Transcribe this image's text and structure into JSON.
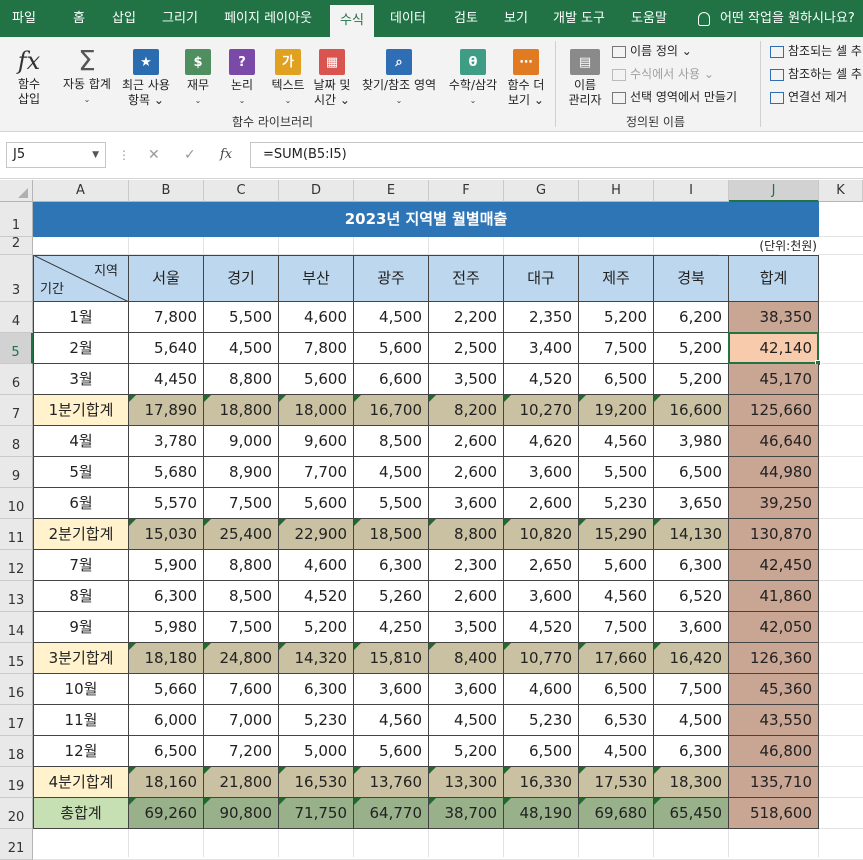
{
  "ribbon_tabs": [
    "파일",
    "홈",
    "삽입",
    "그리기",
    "페이지 레이아웃",
    "수식",
    "데이터",
    "검토",
    "보기",
    "개발 도구",
    "도움말"
  ],
  "active_tab": "수식",
  "tell_me": "어떤 작업을 원하시나요?",
  "ribbon": {
    "insert_function": [
      "함수",
      "삽입"
    ],
    "autosum": [
      "자동 합계",
      "⌄"
    ],
    "recent": [
      "최근 사용",
      "항목 ⌄"
    ],
    "finance": [
      "재무",
      "⌄"
    ],
    "logical": [
      "논리",
      "⌄"
    ],
    "text": [
      "텍스트",
      "⌄"
    ],
    "datetime": [
      "날짜 및",
      "시간 ⌄"
    ],
    "lookup": [
      "찾기/참조 영역",
      "⌄"
    ],
    "math": [
      "수학/삼각",
      "⌄"
    ],
    "more": [
      "함수 더",
      "보기 ⌄"
    ],
    "library_label": "함수 라이브러리",
    "name_manager": [
      "이름",
      "관리자"
    ],
    "define_name": "이름 정의 ⌄",
    "use_in_formula": "수식에서 사용 ⌄",
    "create_from_selection": "선택 영역에서 만들기",
    "defined_names_label": "정의된 이름",
    "trace_precedents": "참조되는 셀 추",
    "trace_dependents": "참조하는 셀 추",
    "remove_arrows": "연결선 제거"
  },
  "name_box": "J5",
  "formula": "=SUM(B5:I5)",
  "columns": [
    "A",
    "B",
    "C",
    "D",
    "E",
    "F",
    "G",
    "H",
    "I",
    "J",
    "K"
  ],
  "rows": [
    "1",
    "2",
    "3",
    "4",
    "5",
    "6",
    "7",
    "8",
    "9",
    "10",
    "11",
    "12",
    "13",
    "14",
    "15",
    "16",
    "17",
    "18",
    "19",
    "20",
    "21"
  ],
  "title": "2023년 지역별 월별매출",
  "unit": "(단위:천원)",
  "corner_top": "지역",
  "corner_bottom": "기간",
  "regions": [
    "서울",
    "경기",
    "부산",
    "광주",
    "전주",
    "대구",
    "제주",
    "경북"
  ],
  "total_header": "합계",
  "table": [
    {
      "label": "1월",
      "type": "month",
      "values": [
        "7,800",
        "5,500",
        "4,600",
        "4,500",
        "2,200",
        "2,350",
        "5,200",
        "6,200"
      ],
      "total": "38,350"
    },
    {
      "label": "2월",
      "type": "month",
      "values": [
        "5,640",
        "4,500",
        "7,800",
        "5,600",
        "2,500",
        "3,400",
        "7,500",
        "5,200"
      ],
      "total": "42,140"
    },
    {
      "label": "3월",
      "type": "month",
      "values": [
        "4,450",
        "8,800",
        "5,600",
        "6,600",
        "3,500",
        "4,520",
        "6,500",
        "5,200"
      ],
      "total": "45,170"
    },
    {
      "label": "1분기합계",
      "type": "quarter",
      "values": [
        "17,890",
        "18,800",
        "18,000",
        "16,700",
        "8,200",
        "10,270",
        "19,200",
        "16,600"
      ],
      "total": "125,660"
    },
    {
      "label": "4월",
      "type": "month",
      "values": [
        "3,780",
        "9,000",
        "9,600",
        "8,500",
        "2,600",
        "4,620",
        "4,560",
        "3,980"
      ],
      "total": "46,640"
    },
    {
      "label": "5월",
      "type": "month",
      "values": [
        "5,680",
        "8,900",
        "7,700",
        "4,500",
        "2,600",
        "3,600",
        "5,500",
        "6,500"
      ],
      "total": "44,980"
    },
    {
      "label": "6월",
      "type": "month",
      "values": [
        "5,570",
        "7,500",
        "5,600",
        "5,500",
        "3,600",
        "2,600",
        "5,230",
        "3,650"
      ],
      "total": "39,250"
    },
    {
      "label": "2분기합계",
      "type": "quarter",
      "values": [
        "15,030",
        "25,400",
        "22,900",
        "18,500",
        "8,800",
        "10,820",
        "15,290",
        "14,130"
      ],
      "total": "130,870"
    },
    {
      "label": "7월",
      "type": "month",
      "values": [
        "5,900",
        "8,800",
        "4,600",
        "6,300",
        "2,300",
        "2,650",
        "5,600",
        "6,300"
      ],
      "total": "42,450"
    },
    {
      "label": "8월",
      "type": "month",
      "values": [
        "6,300",
        "8,500",
        "4,520",
        "5,260",
        "2,600",
        "3,600",
        "4,560",
        "6,520"
      ],
      "total": "41,860"
    },
    {
      "label": "9월",
      "type": "month",
      "values": [
        "5,980",
        "7,500",
        "5,200",
        "4,250",
        "3,500",
        "4,520",
        "7,500",
        "3,600"
      ],
      "total": "42,050"
    },
    {
      "label": "3분기합계",
      "type": "quarter",
      "values": [
        "18,180",
        "24,800",
        "14,320",
        "15,810",
        "8,400",
        "10,770",
        "17,660",
        "16,420"
      ],
      "total": "126,360"
    },
    {
      "label": "10월",
      "type": "month",
      "values": [
        "5,660",
        "7,600",
        "6,300",
        "3,600",
        "3,600",
        "4,600",
        "6,500",
        "7,500"
      ],
      "total": "45,360"
    },
    {
      "label": "11월",
      "type": "month",
      "values": [
        "6,000",
        "7,000",
        "5,230",
        "4,560",
        "4,500",
        "5,230",
        "6,530",
        "4,500"
      ],
      "total": "43,550"
    },
    {
      "label": "12월",
      "type": "month",
      "values": [
        "6,500",
        "7,200",
        "5,000",
        "5,600",
        "5,200",
        "6,500",
        "4,500",
        "6,300"
      ],
      "total": "46,800"
    },
    {
      "label": "4분기합계",
      "type": "quarter",
      "values": [
        "18,160",
        "21,800",
        "16,530",
        "13,760",
        "13,300",
        "16,330",
        "17,530",
        "18,300"
      ],
      "total": "135,710"
    },
    {
      "label": "총합계",
      "type": "grand",
      "values": [
        "69,260",
        "90,800",
        "71,750",
        "64,770",
        "38,700",
        "48,190",
        "69,680",
        "65,450"
      ],
      "total": "518,600"
    }
  ],
  "colors": {
    "excel_green": "#217346",
    "title_band": "#2e75b6",
    "header_fill": "#bdd7ee",
    "quarter_label": "#fff2cc",
    "quarter_fill": "#c9c1a2",
    "total_fill": "#c9a593",
    "grand_label": "#c6e0b4",
    "grand_fill": "#98b18b",
    "selected_cell": "#f8cbad"
  }
}
